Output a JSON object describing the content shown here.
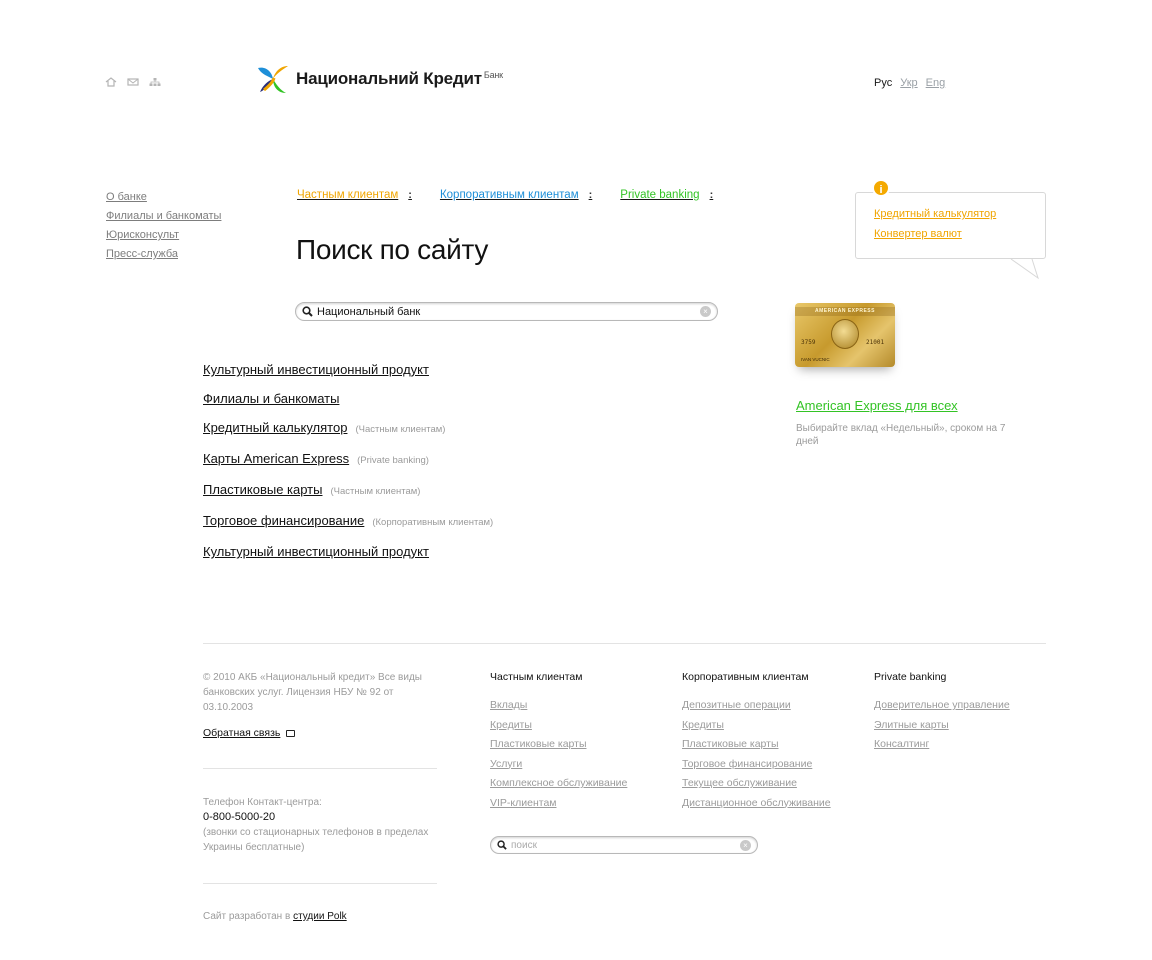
{
  "header": {
    "icons": [
      "home-icon",
      "mail-icon",
      "sitemap-icon"
    ],
    "logo_text": "Национальний Кредит",
    "logo_sup": "Банк",
    "languages": [
      {
        "label": "Рус",
        "active": true
      },
      {
        "label": "Укр",
        "active": false
      },
      {
        "label": "Eng",
        "active": false
      }
    ]
  },
  "left_nav": {
    "items": [
      "О банке",
      "Филиалы и банкоматы",
      "Юрисконсульт",
      "Пресс-служба"
    ]
  },
  "tabs": [
    {
      "label": "Частным клиентам",
      "color": "#f0a500",
      "dots": ":"
    },
    {
      "label": "Корпоративным клиентам",
      "color": "#1e8fd8",
      "dots": ":"
    },
    {
      "label": "Private banking",
      "color": "#33c325",
      "dots": ":"
    }
  ],
  "page_title": "Поиск по сайту",
  "search": {
    "value": "Национальный банк",
    "clear_glyph": "×"
  },
  "results": [
    {
      "title": "Культурный инвестиционный продукт",
      "category": ""
    },
    {
      "title": "Филиалы и банкоматы",
      "category": ""
    },
    {
      "title": "Кредитный калькулятор",
      "category": "(Частным клиентам)"
    },
    {
      "title": "Карты American Express",
      "category": "(Private banking)"
    },
    {
      "title": "Пластиковые карты",
      "category": "(Частным клиентам)"
    },
    {
      "title": "Торговое финансирование",
      "category": "(Корпоративным клиентам)"
    },
    {
      "title": "Культурный инвестиционный продукт",
      "category": ""
    }
  ],
  "callout": {
    "icon_glyph": "i",
    "links": [
      "Кредитный калькулятор",
      "Конвертер валют"
    ]
  },
  "promo": {
    "card": {
      "band": "AMERICAN EXPRESS",
      "number_left": "3759",
      "number_right": "21001",
      "name": "IVAN VUCNIC"
    },
    "title": "American Express для всех",
    "description": "Выбирайте вклад «Недельный», сроком на 7 дней"
  },
  "footer": {
    "copyright": "© 2010 АКБ «Национальный кредит» Все виды банковских услуг. Лицензия НБУ № 92 от 03.10.2003",
    "feedback_label": "Обратная связь",
    "phone_label": "Телефон Контакт-центра:",
    "phone_number": "0-800-5000-20",
    "phone_note": "(звонки со стационарных телефонов в пределах Украины бесплатные)",
    "credits_prefix": "Сайт разработан в",
    "credits_link": "студии Polk",
    "columns": [
      {
        "title": "Частным клиентам",
        "links": [
          "Вклады",
          "Кредиты",
          "Пластиковые карты",
          "Услуги",
          "Комплексное обслуживание",
          "VIP-клиентам"
        ]
      },
      {
        "title": "Корпоративным клиентам",
        "links": [
          "Депозитные операции",
          "Кредиты",
          "Пластиковые карты",
          "Торговое финансирование",
          "Текущее обслуживание",
          "Дистанционное обслуживание"
        ]
      },
      {
        "title": "Private banking",
        "links": [
          "Доверительное управление",
          "Элитные карты",
          "Консалтинг"
        ]
      }
    ],
    "search_placeholder": "поиск"
  }
}
